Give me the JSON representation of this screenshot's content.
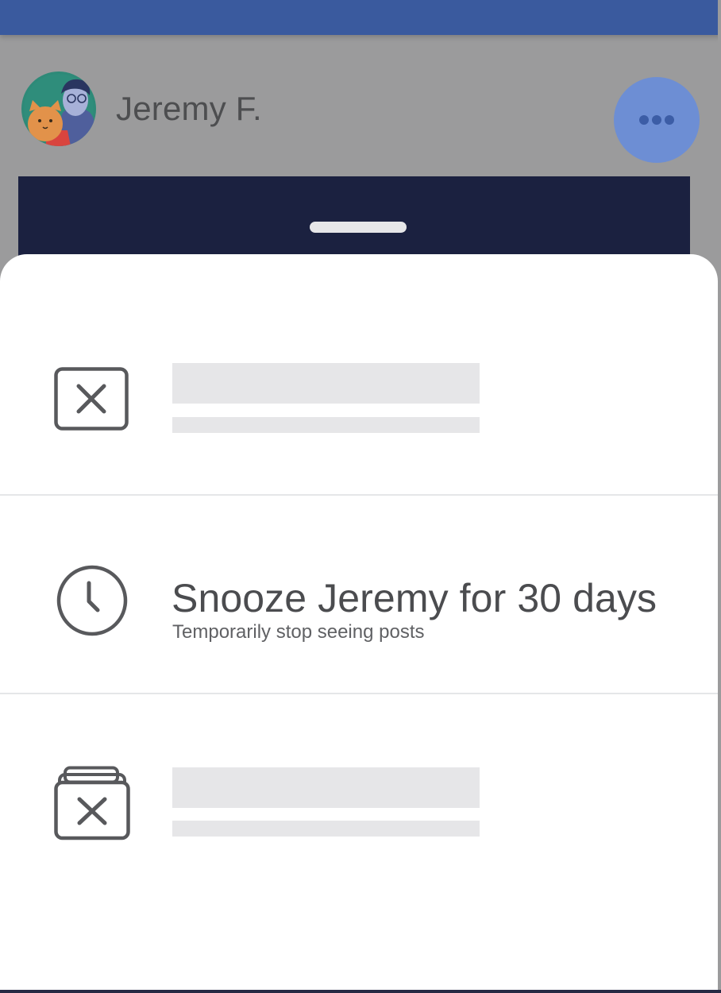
{
  "post": {
    "author_name": "Jeremy F.",
    "avatar_icon": "avatar-illustration-icon",
    "more_icon": "more-horizontal-icon"
  },
  "sheet": {
    "options": [
      {
        "icon": "close-box-icon",
        "title": "",
        "subtitle": ""
      },
      {
        "icon": "clock-icon",
        "title": "Snooze Jeremy for 30 days",
        "subtitle": "Temporarily stop seeing posts"
      },
      {
        "icon": "close-stack-icon",
        "title": "",
        "subtitle": ""
      }
    ]
  },
  "colors": {
    "top_bar": "#3a5a9e",
    "more_button": "#6d8ed4",
    "media_dark": "#1b2140",
    "placeholder": "#e6e6e8",
    "text": "#4b4c4f"
  }
}
